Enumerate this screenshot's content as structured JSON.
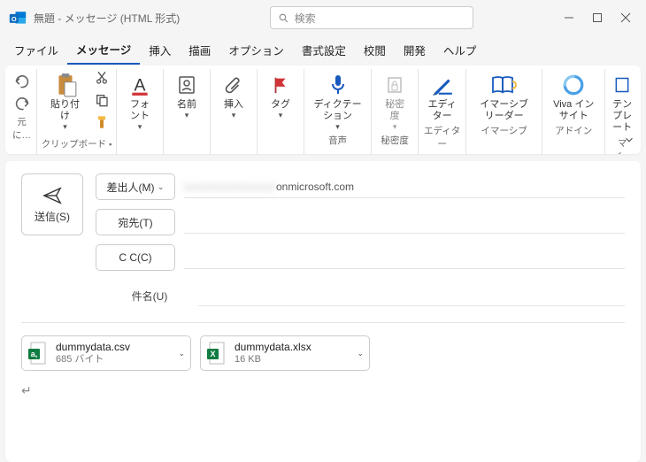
{
  "title": "無題 - メッセージ (HTML 形式)",
  "search_placeholder": "検索",
  "menu": {
    "file": "ファイル",
    "message": "メッセージ",
    "insert": "挿入",
    "draw": "描画",
    "options": "オプション",
    "format": "書式設定",
    "review": "校閲",
    "developer": "開発",
    "help": "ヘルプ"
  },
  "ribbon": {
    "undo_group": "元に…",
    "paste": "貼り付け",
    "clipboard_group": "クリップボード",
    "font": "フォント",
    "names": "名前",
    "insert": "挿入",
    "tags": "タグ",
    "dictation": "ディクテーション",
    "voice_group": "音声",
    "sensitivity": "秘密度",
    "sensitivity_group": "秘密度",
    "editor": "エディター",
    "editor_group": "エディター",
    "immersive": "イマーシブ リーダー",
    "immersive_group": "イマーシブ",
    "viva": "Viva インサイト",
    "addin_group": "アドイン",
    "template": "テンプレート",
    "my_group": "マイ…"
  },
  "compose": {
    "send": "送信(S)",
    "from": "差出人(M)",
    "from_value_hidden": "xxxxxxxxxxxxxxxx",
    "from_value_suffix": "onmicrosoft.com",
    "to": "宛先(T)",
    "cc": "C C(C)",
    "subject_label": "件名(U)"
  },
  "attachments": [
    {
      "name": "dummydata.csv",
      "size": "685 バイト",
      "type": "csv"
    },
    {
      "name": "dummydata.xlsx",
      "size": "16 KB",
      "type": "xlsx"
    }
  ]
}
